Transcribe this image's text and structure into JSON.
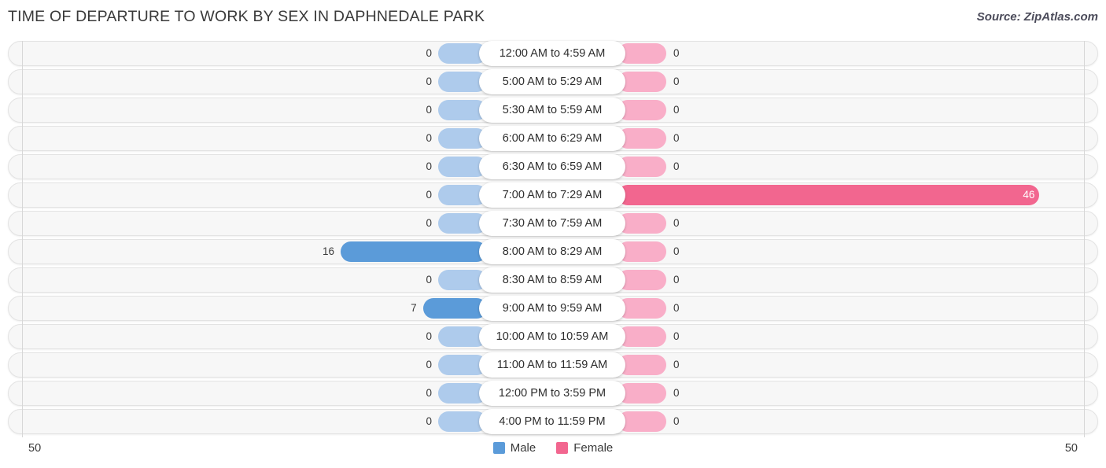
{
  "header": {
    "title": "TIME OF DEPARTURE TO WORK BY SEX IN DAPHNEDALE PARK",
    "source": "Source: ZipAtlas.com"
  },
  "axis": {
    "left_label": "50",
    "right_label": "50",
    "max": 50
  },
  "legend": [
    {
      "label": "Male",
      "color": "#5b9bd9"
    },
    {
      "label": "Female",
      "color": "#f2668f"
    }
  ],
  "colors": {
    "male": "#5b9bd9",
    "female": "#f2668f",
    "male_zero": "#aecbec",
    "female_zero": "#f9aec8",
    "row_track": "#f7f7f7",
    "gridline": "#d7d7d7"
  },
  "chart_data": {
    "type": "bar",
    "orientation": "horizontal-diverging",
    "title": "TIME OF DEPARTURE TO WORK BY SEX IN DAPHNEDALE PARK",
    "xlabel": "",
    "ylabel": "",
    "xlim": [
      50,
      50
    ],
    "grid": true,
    "legend_position": "bottom-center",
    "categories": [
      "12:00 AM to 4:59 AM",
      "5:00 AM to 5:29 AM",
      "5:30 AM to 5:59 AM",
      "6:00 AM to 6:29 AM",
      "6:30 AM to 6:59 AM",
      "7:00 AM to 7:29 AM",
      "7:30 AM to 7:59 AM",
      "8:00 AM to 8:29 AM",
      "8:30 AM to 8:59 AM",
      "9:00 AM to 9:59 AM",
      "10:00 AM to 10:59 AM",
      "11:00 AM to 11:59 AM",
      "12:00 PM to 3:59 PM",
      "4:00 PM to 11:59 PM"
    ],
    "series": [
      {
        "name": "Male",
        "color": "#5b9bd9",
        "side": "left",
        "values": [
          0,
          0,
          0,
          0,
          0,
          0,
          0,
          16,
          0,
          7,
          0,
          0,
          0,
          0
        ]
      },
      {
        "name": "Female",
        "color": "#f2668f",
        "side": "right",
        "values": [
          0,
          0,
          0,
          0,
          0,
          46,
          0,
          0,
          0,
          0,
          0,
          0,
          0,
          0
        ]
      }
    ]
  },
  "rows": [
    {
      "label": "12:00 AM to 4:59 AM",
      "male": "0",
      "female": "0"
    },
    {
      "label": "5:00 AM to 5:29 AM",
      "male": "0",
      "female": "0"
    },
    {
      "label": "5:30 AM to 5:59 AM",
      "male": "0",
      "female": "0"
    },
    {
      "label": "6:00 AM to 6:29 AM",
      "male": "0",
      "female": "0"
    },
    {
      "label": "6:30 AM to 6:59 AM",
      "male": "0",
      "female": "0"
    },
    {
      "label": "7:00 AM to 7:29 AM",
      "male": "0",
      "female": "46"
    },
    {
      "label": "7:30 AM to 7:59 AM",
      "male": "0",
      "female": "0"
    },
    {
      "label": "8:00 AM to 8:29 AM",
      "male": "16",
      "female": "0"
    },
    {
      "label": "8:30 AM to 8:59 AM",
      "male": "0",
      "female": "0"
    },
    {
      "label": "9:00 AM to 9:59 AM",
      "male": "7",
      "female": "0"
    },
    {
      "label": "10:00 AM to 10:59 AM",
      "male": "0",
      "female": "0"
    },
    {
      "label": "11:00 AM to 11:59 AM",
      "male": "0",
      "female": "0"
    },
    {
      "label": "12:00 PM to 3:59 PM",
      "male": "0",
      "female": "0"
    },
    {
      "label": "4:00 PM to 11:59 PM",
      "male": "0",
      "female": "0"
    }
  ]
}
